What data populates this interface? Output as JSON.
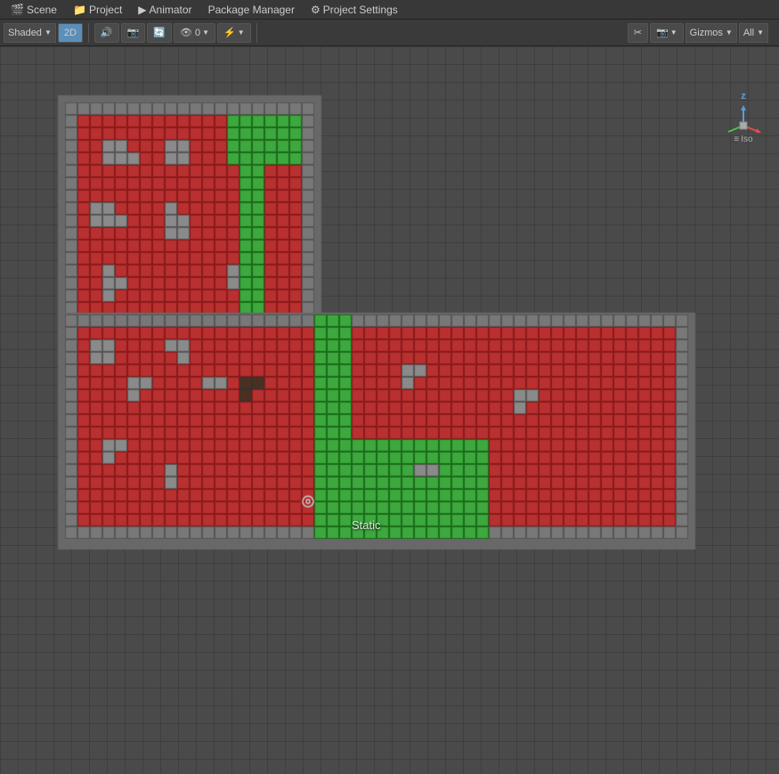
{
  "menubar": {
    "items": [
      {
        "label": "Scene",
        "icon": ""
      },
      {
        "label": "Project",
        "icon": "📁"
      },
      {
        "label": "Animator",
        "icon": "▶"
      },
      {
        "label": "Package Manager",
        "icon": ""
      },
      {
        "label": "Project Settings",
        "icon": "⚙"
      }
    ]
  },
  "toolbar": {
    "left": {
      "mode_label": "Shaded",
      "mode_2d": "2D",
      "buttons": [
        "🔊",
        "📷",
        "🔄",
        "👁 0",
        "⚡"
      ]
    },
    "right": {
      "buttons": [
        "✂",
        "📷",
        "Gizmos ▼",
        "All"
      ]
    }
  },
  "viewport": {
    "static_label": "Static",
    "gizmo": {
      "z_label": "z",
      "iso_label": "Iso"
    }
  },
  "colors": {
    "red_tile": "#c0392b",
    "green_tile": "#27ae60",
    "gray_floor": "#6c6c6c",
    "dark_floor": "#4a4a4a",
    "wall": "#808080",
    "bg": "#4a4a4a"
  }
}
